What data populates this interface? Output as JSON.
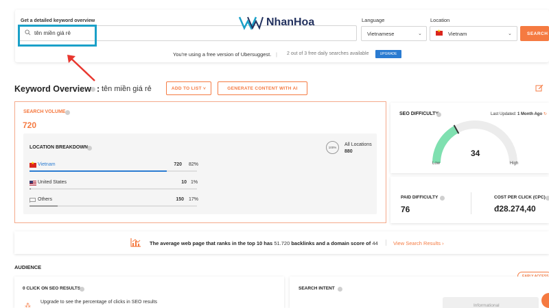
{
  "search": {
    "label": "Get a detailed keyword overview",
    "value": "tên miền giá rẻ",
    "search_button": "SEARCH"
  },
  "brand": {
    "logo_text": "NhanHoa",
    "logo_color": "#23325f"
  },
  "language": {
    "label": "Language",
    "selected": "Vietnamese"
  },
  "location": {
    "label": "Location",
    "selected": "Vietnam"
  },
  "free_notice": {
    "text": "You're using a free version of Ubersuggest.",
    "separator": "|",
    "count_text": "2 out of 3 free daily searches available",
    "upgrade_label": "UPGRADE"
  },
  "overview": {
    "title": "Keyword Overview",
    "colon": ":",
    "keyword": "tên miền giá rẻ",
    "add_to_list": "ADD TO LIST ˅",
    "generate_content": "GENERATE CONTENT WITH AI"
  },
  "search_volume": {
    "label": "SEARCH VOLUME",
    "value": "720",
    "breakdown_label": "LOCATION BREAKDOWN",
    "all_locations_badge": "100%",
    "all_locations_label": "All Locations",
    "all_locations_value": "880",
    "rows": [
      {
        "name": "Vietnam",
        "value": "720",
        "percent": "82%",
        "fill": 0.82
      },
      {
        "name": "United States",
        "value": "10",
        "percent": "1%",
        "fill": 0.01
      },
      {
        "name": "Others",
        "value": "150",
        "percent": "17%",
        "fill": 0.17
      }
    ]
  },
  "seo_difficulty": {
    "label": "SEO DIFFICULTY",
    "last_updated_prefix": "Last Updated: ",
    "last_updated_value": "1 Month Ago",
    "value": "34",
    "fill": 0.34,
    "low_label": "Low",
    "high_label": "High"
  },
  "paid": {
    "label": "PAID DIFFICULTY",
    "value": "76"
  },
  "cpc": {
    "label": "COST PER CLICK (CPC)",
    "value": "đ28.274,40"
  },
  "backlinks": {
    "text_prefix": "The average web page that ranks in the top 10 has ",
    "backlinks_value": "51.720",
    "text_mid1": " backlinks and a domain score of ",
    "domain_score": "44",
    "link": "View Search Results ›"
  },
  "audience": {
    "title": "AUDIENCE",
    "early_access": "EARLY ACCESS",
    "click_label": "0 CLICK ON SEO RESULTS",
    "click_upgrade": "Upgrade to see the percentage of clicks in SEO results",
    "intent_label": "SEARCH INTENT",
    "intent_value": "Informational"
  },
  "colors": {
    "accent": "#f57a41",
    "link_blue": "#2a7bd1",
    "highlight": "#1aa0c8",
    "arrow": "#e8372f",
    "gauge_green": "#7fe0b0"
  }
}
